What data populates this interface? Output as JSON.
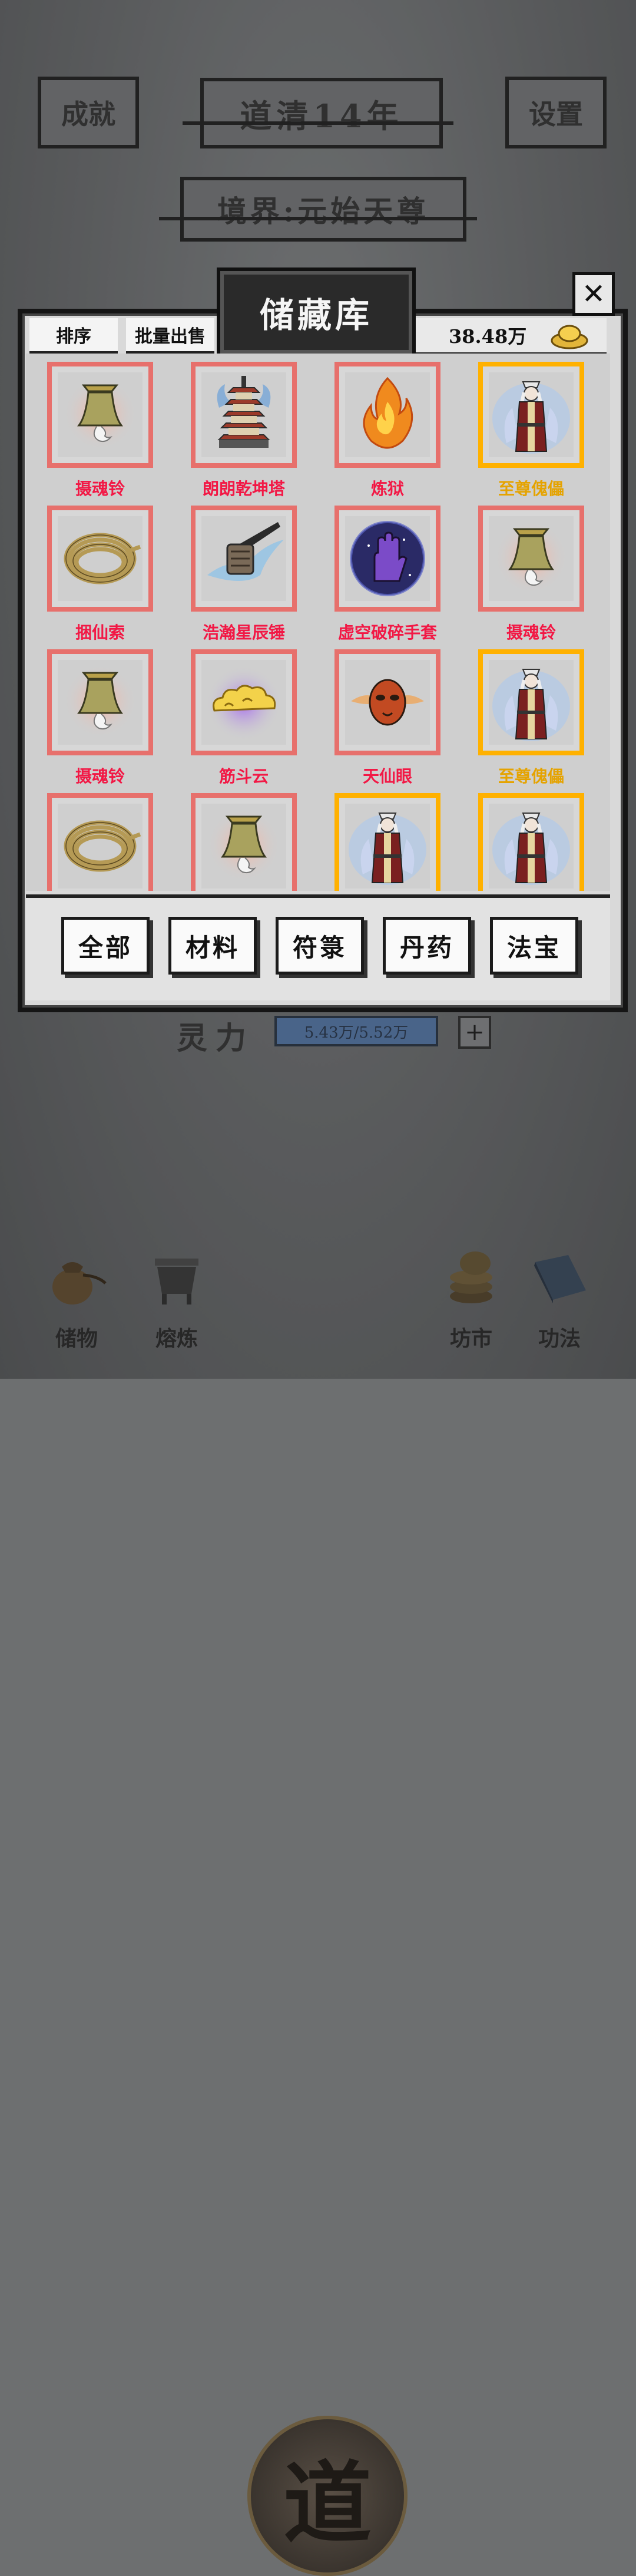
{
  "background": {
    "year_title": "道清14年",
    "realm": "境界:元始天尊",
    "achievements": "成就",
    "settings": "设置",
    "spirit_label": "灵力",
    "spirit_value": "5.43万/5.52万",
    "spirit_plus": "+",
    "nav": [
      {
        "label": "储物",
        "icon": "pouch-icon"
      },
      {
        "label": "熔炼",
        "icon": "cauldron-icon"
      },
      {
        "label": "道",
        "icon": "dao-seal-icon"
      },
      {
        "label": "坊市",
        "icon": "coins-stack-icon"
      },
      {
        "label": "功法",
        "icon": "manual-book-icon"
      }
    ]
  },
  "modal": {
    "title": "储藏库",
    "close": "✕",
    "sort": "排序",
    "batch_sell": "批量出售",
    "currency": "38.48万",
    "colors": {
      "red_rarity": "#e7706c",
      "gold_rarity": "#ffb100",
      "red_text": "#f21845",
      "gold_text": "#e5a300"
    },
    "items": [
      {
        "name": "摄魂铃",
        "rarity": "red",
        "icon": "bell-icon"
      },
      {
        "name": "朗朗乾坤塔",
        "rarity": "red",
        "icon": "pagoda-icon"
      },
      {
        "name": "炼狱",
        "rarity": "red",
        "icon": "flame-icon"
      },
      {
        "name": "至尊傀儡",
        "rarity": "gold",
        "icon": "puppet-icon"
      },
      {
        "name": "捆仙索",
        "rarity": "red",
        "icon": "rope-icon"
      },
      {
        "name": "浩瀚星辰锤",
        "rarity": "red",
        "icon": "hammer-icon"
      },
      {
        "name": "虚空破碎手套",
        "rarity": "red",
        "icon": "gauntlet-icon"
      },
      {
        "name": "摄魂铃",
        "rarity": "red",
        "icon": "bell-icon"
      },
      {
        "name": "摄魂铃",
        "rarity": "red",
        "icon": "bell-icon"
      },
      {
        "name": "筋斗云",
        "rarity": "red",
        "icon": "cloud-icon"
      },
      {
        "name": "天仙眼",
        "rarity": "red",
        "icon": "mask-icon"
      },
      {
        "name": "至尊傀儡",
        "rarity": "gold",
        "icon": "puppet-icon"
      },
      {
        "name": "",
        "rarity": "red",
        "icon": "rope-icon"
      },
      {
        "name": "",
        "rarity": "red",
        "icon": "bell-icon"
      },
      {
        "name": "",
        "rarity": "gold",
        "icon": "puppet-icon"
      },
      {
        "name": "",
        "rarity": "gold",
        "icon": "puppet-icon"
      }
    ],
    "categories": [
      "全部",
      "材料",
      "符箓",
      "丹药",
      "法宝"
    ]
  }
}
